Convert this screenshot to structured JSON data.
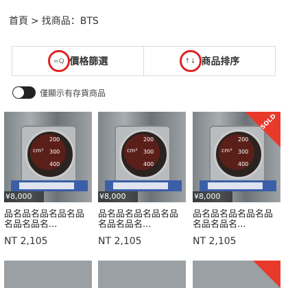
{
  "breadcrumb": {
    "home": "首頁",
    "separator": ">",
    "current": "找商品：BTS"
  },
  "filters": {
    "price_filter_label": "價格篩選",
    "price_filter_icon": "filter-search-icon",
    "sort_label": "商品排序",
    "sort_icon": "sort-arrows-icon"
  },
  "stock_toggle": {
    "label": "僅顯示有存貨商品",
    "on": false
  },
  "products": [
    {
      "overlay_price": "¥8,000",
      "title": "品名品名品名品名品名品名品名...",
      "price": "NT 2,105",
      "sold": false
    },
    {
      "overlay_price": "¥8,000",
      "title": "品名品名品名品名品名品名品名...",
      "price": "NT 2,105",
      "sold": false
    },
    {
      "overlay_price": "¥8,000",
      "title": "品名品名品名品名品名品名品名...",
      "price": "NT 2,105",
      "sold": true,
      "sold_label": "SOLD"
    }
  ],
  "colors": {
    "highlight_circle": "#e02020",
    "sold_badge": "#e8392b"
  }
}
